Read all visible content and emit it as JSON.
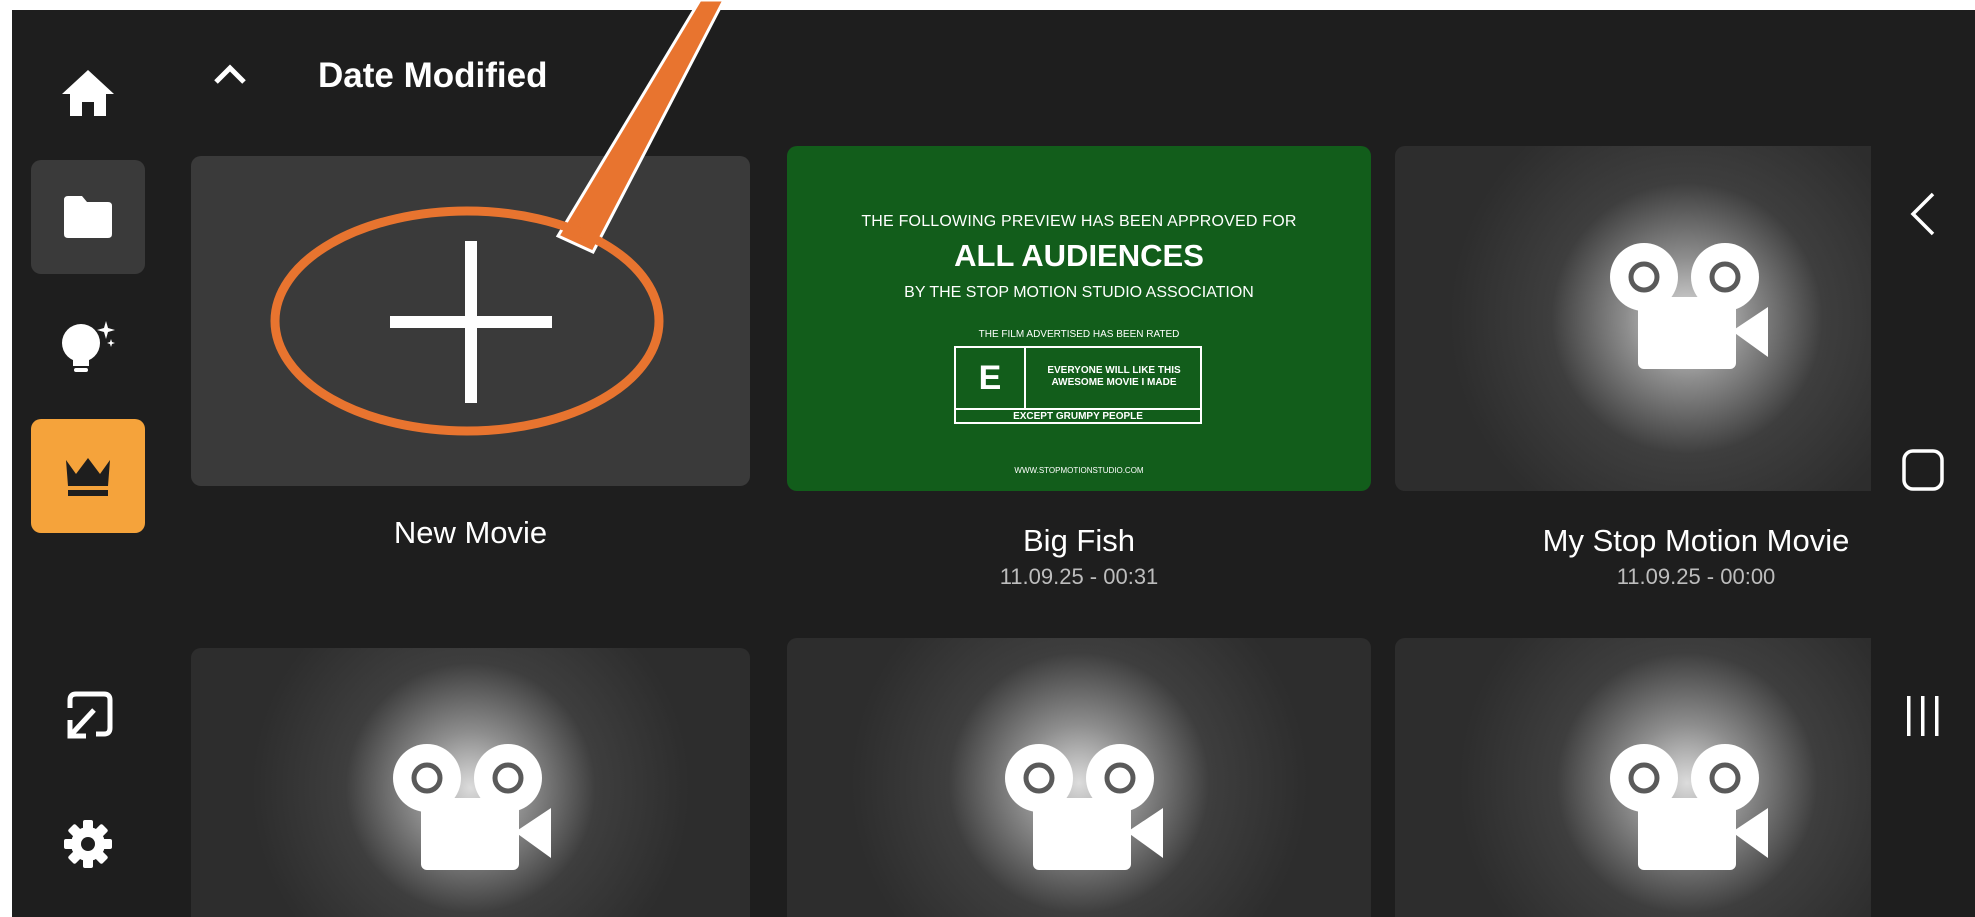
{
  "sidebar": {
    "items": [
      {
        "name": "home",
        "icon": "home-icon"
      },
      {
        "name": "projects",
        "icon": "folder-icon",
        "active": true
      },
      {
        "name": "ideas",
        "icon": "lightbulb-sparkle-icon"
      },
      {
        "name": "premium",
        "icon": "crown-icon",
        "color": "#f5a33b"
      },
      {
        "name": "import",
        "icon": "import-arrow-icon"
      },
      {
        "name": "settings",
        "icon": "gear-icon"
      }
    ]
  },
  "header": {
    "sort_label": "Date Modified",
    "sort_icon": "chevron-up-icon"
  },
  "grid": {
    "new_movie": {
      "title": "New Movie",
      "icon": "plus-icon"
    },
    "movies": [
      {
        "title": "Big Fish",
        "date": "11.09.25 - 00:31"
      },
      {
        "title": "My Stop Motion Movie",
        "date": "11.09.25 - 00:00"
      }
    ],
    "row2_icons": [
      "movie-camera-icon",
      "movie-camera-icon",
      "movie-camera-icon"
    ]
  },
  "preview_card": {
    "line1": "THE FOLLOWING PREVIEW HAS BEEN APPROVED FOR",
    "line2": "ALL AUDIENCES",
    "line3": "BY THE STOP MOTION STUDIO ASSOCIATION",
    "rated": "THE FILM ADVERTISED HAS BEEN RATED",
    "rating": "E",
    "rating_desc": "EVERYONE WILL LIKE THIS AWESOME MOVIE I MADE",
    "except": "EXCEPT GRUMPY PEOPLE",
    "url": "WWW.STOPMOTIONSTUDIO.COM",
    "background": "#125d1b"
  },
  "system_nav": {
    "icons": [
      "back-icon",
      "home-square-icon",
      "recents-icon"
    ]
  },
  "annotation": {
    "color": "#e8742f",
    "shape": "ellipse-with-pointer"
  },
  "colors": {
    "background": "#1e1e1e",
    "card": "#3a3a3a",
    "accent": "#f5a33b"
  }
}
